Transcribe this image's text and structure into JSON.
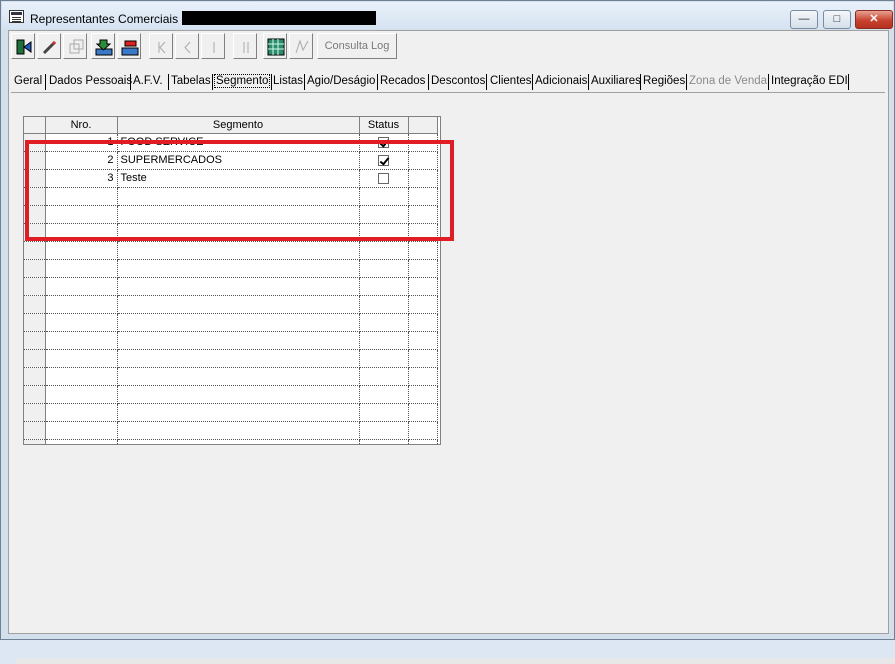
{
  "window": {
    "title": "Representantes Comerciais -"
  },
  "toolbar": {
    "buttons": [
      {
        "icon": "exit-door-icon",
        "enabled": true
      },
      {
        "icon": "eraser-icon",
        "enabled": true
      },
      {
        "icon": "copy-icon",
        "enabled": false
      },
      {
        "icon": "save-download-icon",
        "enabled": true
      },
      {
        "icon": "delete-record-icon",
        "enabled": true
      },
      {
        "icon": "first-record-icon",
        "enabled": false
      },
      {
        "icon": "previous-record-icon",
        "enabled": false
      },
      {
        "icon": "next-record-icon",
        "enabled": false
      },
      {
        "icon": "last-record-icon",
        "enabled": false
      },
      {
        "icon": "grid-view-icon",
        "enabled": true
      },
      {
        "icon": "print-icon",
        "enabled": false
      }
    ],
    "log_label": "Consulta Log"
  },
  "tabs": [
    {
      "label": "Geral"
    },
    {
      "label": "Dados Pessoais"
    },
    {
      "label": "A.F.V."
    },
    {
      "label": "Tabelas"
    },
    {
      "label": "Segmento",
      "active": true
    },
    {
      "label": "Listas"
    },
    {
      "label": "Agio/Deságio"
    },
    {
      "label": "Recados"
    },
    {
      "label": "Descontos"
    },
    {
      "label": "Clientes"
    },
    {
      "label": "Adicionais"
    },
    {
      "label": "Auxiliares"
    },
    {
      "label": "Regiões"
    },
    {
      "label": "Zona de Venda",
      "disabled": true
    },
    {
      "label": "Integração EDI"
    }
  ],
  "grid": {
    "columns": {
      "nro": "Nro.",
      "segmento": "Segmento",
      "status": "Status"
    },
    "rows": [
      {
        "nro": "1",
        "segmento": "FOOD SERVICE",
        "status": true
      },
      {
        "nro": "2",
        "segmento": "SUPERMERCADOS",
        "status": true
      },
      {
        "nro": "3",
        "segmento": "Teste",
        "status": false
      }
    ],
    "empty_rows": 15
  },
  "colors": {
    "highlight": "#e01c24",
    "chrome": "#d4dfec",
    "close_button": "#c7432f"
  }
}
